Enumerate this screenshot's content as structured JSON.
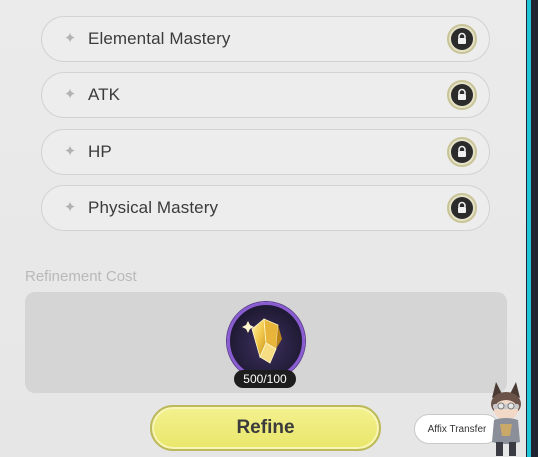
{
  "affixes": [
    {
      "label": "Elemental Mastery",
      "locked": true
    },
    {
      "label": "ATK",
      "locked": true
    },
    {
      "label": "HP",
      "locked": true
    },
    {
      "label": "Physical Mastery",
      "locked": true
    }
  ],
  "cost": {
    "label": "Refinement Cost",
    "owned": "500",
    "required": "/100"
  },
  "buttons": {
    "refine": "Refine",
    "affix_transfer": "Affix Transfer"
  },
  "colors": {
    "refine_button": "#e9e66b",
    "material_ring": "#8a5cd2",
    "sidebar_accent": "#21c5d8"
  },
  "icons": {
    "row_marker": "four-point-star-icon",
    "lock": "padlock-icon",
    "material": "golden-crystal-icon",
    "helper": "character-avatar"
  }
}
